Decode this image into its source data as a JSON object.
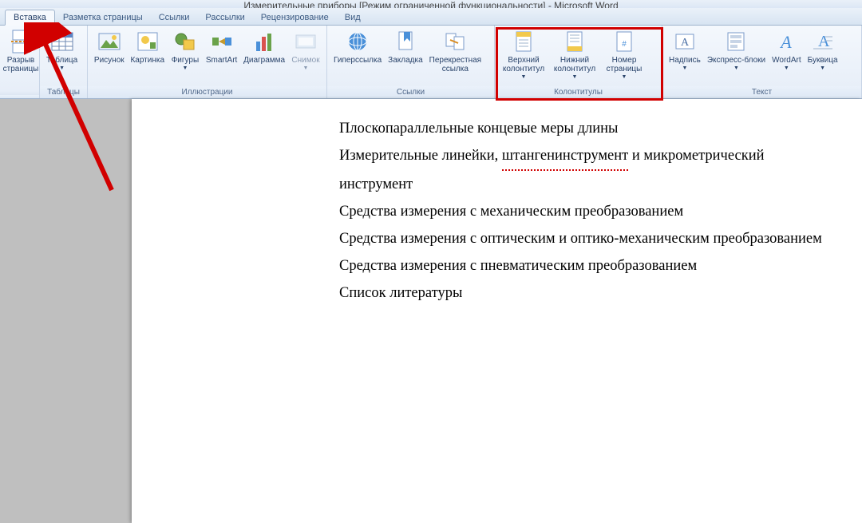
{
  "title": "Измерительные приборы [Режим ограниченной функциональности] - Microsoft Word",
  "tabs": {
    "insert": "Вставка",
    "layout": "Разметка страницы",
    "refs": "Ссылки",
    "mail": "Рассылки",
    "review": "Рецензирование",
    "view": "Вид"
  },
  "ribbon": {
    "pages": {
      "pagebreak": "Разрыв\nстраницы",
      "group": ""
    },
    "tables": {
      "table": "Таблица",
      "group": "Таблицы"
    },
    "illus": {
      "picture": "Рисунок",
      "clipart": "Картинка",
      "shapes": "Фигуры",
      "smartart": "SmartArt",
      "chart": "Диаграмма",
      "screenshot": "Снимок",
      "group": "Иллюстрации"
    },
    "links": {
      "hyperlink": "Гиперссылка",
      "bookmark": "Закладка",
      "crossref": "Перекрестная\nссылка",
      "group": "Ссылки"
    },
    "hf": {
      "header": "Верхний\nколонтитул",
      "footer": "Нижний\nколонтитул",
      "pagenum": "Номер\nстраницы",
      "group": "Колонтитулы"
    },
    "text": {
      "textbox": "Надпись",
      "quickparts": "Экспресс-блоки",
      "wordart": "WordArt",
      "dropcap": "Буквица",
      "group": "Текст"
    }
  },
  "doc": {
    "l1": "Плоскопараллельные концевые меры длины",
    "l2a": "Измерительные линейки, ",
    "l2b": "штангенинструмент",
    "l2c": " и микрометрический",
    "l3": "инструмент",
    "l4": "Средства измерения с механическим преобразованием",
    "l5": "Средства измерения с оптическим и оптико-механическим преобразованием",
    "l6": "Средства измерения с пневматическим преобразованием",
    "l7": "Список литературы"
  }
}
